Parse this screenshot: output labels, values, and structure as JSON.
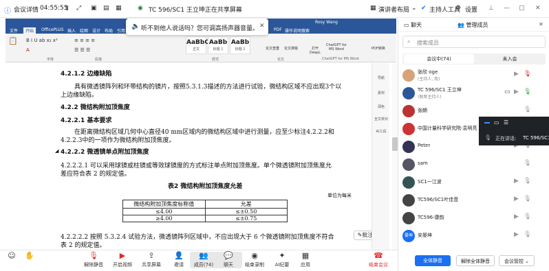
{
  "topbar": {
    "meeting_details": "会议详情",
    "time": "04:55:55",
    "share_title": "TC 596/SC1 王立坤正在共享屏幕",
    "speaker_layout": "演讲者布局",
    "host_tools": "主持人工具",
    "settings": "设置"
  },
  "word": {
    "doc_title": "Rosy Wang",
    "tabs": [
      "文件",
      "开始",
      "OfficePLUS",
      "插入",
      "绘图",
      "设计",
      "布局",
      "引用",
      "邮件",
      "审阅",
      "视图",
      "帮助",
      "PDF工具集",
      "百度网盘",
      "PDF",
      "操作说明搜索"
    ],
    "styles": [
      {
        "sample": "AaBbC",
        "name": "正文"
      },
      {
        "sample": "AaBb",
        "name": "标题 1"
      },
      {
        "sample": "AaBb",
        "name": "标题 2"
      }
    ],
    "ribbon_labels": [
      "论文查重",
      "论文排版",
      "打开 DeepL",
      "ChatGPT for MS Word",
      "ChatGPT for MS Word",
      "PDF转换"
    ],
    "ribbon_groups": [
      "字体",
      "段落",
      "样式",
      "编辑",
      "论文",
      "DeepL",
      "ChatGPT for MS Word",
      "PDF转换"
    ]
  },
  "notice": {
    "text": "听不到他人说话吗？您可调高扬声器音量。"
  },
  "document": {
    "h1": "4.2.1.2  边缘缺陷",
    "p1a": "具有微透镜阵列和环带结构的镜片，按照5.3.1.3描述的方法进行试验，微结构区域不应出现3个以",
    "p1b": "上边缘缺陷。",
    "h2": "4.2.2    微结构附加顶焦度",
    "h3": "4.2.2.1    基本要求",
    "p2a": "在距离微结构区域几何中心直径40  mm区域内的微结构区域中进行测量，应至少标注4.2.2.2和",
    "p2b": "4.2.2.3中的一项作为微结构附加顶焦度。",
    "h4": "4.2.2.2    微透镜单点附加顶焦度",
    "p3a": "4.2.2.2.1   可以采用球镜或柱镜或等效球镜度的方式标注单点附加顶焦度。单个微透镜附加顶焦度允",
    "p3b": "差应符合表 2 的规定值。",
    "table_title": "表2    微结构附加顶焦度允差",
    "unit": "单位为每米",
    "table_headers": [
      "微结构附加顶焦度标称值",
      "允差"
    ],
    "table_rows": [
      [
        "≤4.00",
        "≤±0.50"
      ],
      [
        "≥4.00",
        "≤±0.75"
      ]
    ],
    "p4a": "4.2.2.2.2   按照 5.3.2.4 试验方法，微透镜阵列区域中，不应出现大于 6 个微透镜附加顶焦度不符合",
    "p4b": "表 2 的规定值。"
  },
  "side_tools": [
    "导航",
    "素材",
    "润色",
    "全文校对",
    "AI工具"
  ],
  "annotate": "批注",
  "bottombar": [
    {
      "label": "解除静音",
      "icon": "mic-muted-icon"
    },
    {
      "label": "开启视频",
      "icon": "video-off-icon"
    },
    {
      "label": "共享屏幕",
      "icon": "share-screen-icon"
    },
    {
      "label": "邀请",
      "icon": "invite-icon"
    },
    {
      "label": "成员(74)",
      "icon": "members-icon"
    },
    {
      "label": "聊天",
      "icon": "chat-icon"
    },
    {
      "label": "结束录制",
      "icon": "record-icon"
    },
    {
      "label": "AI纪要",
      "icon": "ai-icon"
    },
    {
      "label": "应用",
      "icon": "apps-icon"
    }
  ],
  "end_meeting": "结束会议",
  "panel": {
    "tab_chat": "聊天",
    "tab_manage": "管理成员",
    "search_placeholder": "搜索成员",
    "in_meeting": "会议中(74)",
    "not_joined": "未入会",
    "members": [
      {
        "name": "张欣 oge",
        "sub": "(主持人, 我)",
        "initials": "张"
      },
      {
        "name": "TC 596/SC1 王立坤",
        "sub": "(联席主持人)",
        "initials": "TC"
      },
      {
        "name": "张朗",
        "sub": "",
        "initials": "张"
      },
      {
        "name": "中国计量科学研究院-袁明亮",
        "sub": "",
        "initials": "中"
      },
      {
        "name": "Peter",
        "sub": "",
        "initials": "P"
      },
      {
        "name": "sam",
        "sub": "",
        "initials": "s"
      },
      {
        "name": "SC1一江波",
        "sub": "",
        "initials": "S"
      },
      {
        "name": "TC596/SC1叶佳音",
        "sub": "",
        "initials": "T"
      },
      {
        "name": "TC596-康韵",
        "sub": "",
        "initials": "T"
      },
      {
        "name": "安晏坤",
        "sub": "",
        "initials": "晏坤"
      }
    ],
    "mute_all": "全体静音",
    "unmute_all": "解除全体静音",
    "control": "会议管控"
  },
  "speaking": {
    "label": "正在讲话:",
    "name": "TC 596/SC1"
  },
  "colors": {
    "word_blue": "#2b579a",
    "accent": "#1a6ff3",
    "end_red": "#e02828"
  }
}
